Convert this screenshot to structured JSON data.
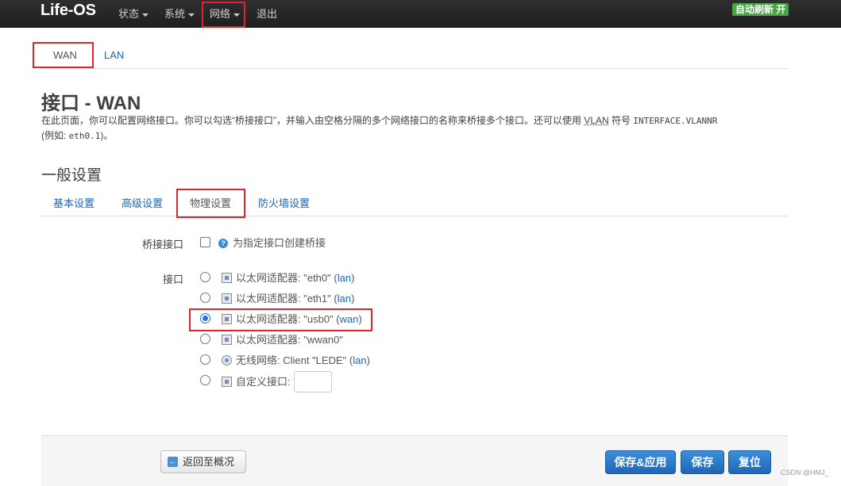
{
  "navbar": {
    "brand": "Life-OS",
    "menu": [
      {
        "label": "状态"
      },
      {
        "label": "系统"
      },
      {
        "label": "网络"
      },
      {
        "label": "退出"
      }
    ],
    "autorefresh": "自动刷新 开"
  },
  "page_tabs": [
    {
      "label": "WAN",
      "active": true
    },
    {
      "label": "LAN",
      "active": false
    }
  ],
  "title": "接口 - WAN",
  "description": {
    "text1": "在此页面，你可以配置网络接口。你可以勾选“桥接接口”，并输入由空格分隔的多个网络接口的名称来桥接多个接口。还可以使用 ",
    "vlan": "VLAN",
    "text2": " 符号 ",
    "mono1": "INTERFACE.VLANNR",
    "text3": "(例如: ",
    "mono2": "eth0.1",
    "text4": ")。"
  },
  "section_title": "一般设置",
  "section_tabs": [
    {
      "label": "基本设置"
    },
    {
      "label": "高级设置"
    },
    {
      "label": "物理设置"
    },
    {
      "label": "防火墙设置"
    }
  ],
  "bridge": {
    "label": "桥接接口",
    "checked": false,
    "help_text": "为指定接口创建桥接"
  },
  "interface": {
    "label": "接口",
    "options": [
      {
        "text": "以太网适配器: \"eth0\"",
        "zone": "lan",
        "icon": "ethernet-icon",
        "checked": false
      },
      {
        "text": "以太网适配器: \"eth1\"",
        "zone": "lan",
        "icon": "ethernet-icon",
        "checked": false
      },
      {
        "text": "以太网适配器: \"usb0\"",
        "zone": "wan",
        "icon": "ethernet-icon",
        "checked": true
      },
      {
        "text": "以太网适配器: \"wwan0\"",
        "zone": "",
        "icon": "ethernet-icon",
        "checked": false
      },
      {
        "text": "无线网络: Client \"LEDE\"",
        "zone": "lan",
        "icon": "wifi-icon",
        "checked": false
      },
      {
        "text": "自定义接口:",
        "zone": "",
        "icon": "ethernet-icon",
        "checked": false
      }
    ],
    "custom_value": ""
  },
  "footer": {
    "back_label": "返回至概况",
    "save_apply_label": "保存&应用",
    "save_label": "保存",
    "reset_label": "复位"
  },
  "watermark": "CSDN @HMJ_",
  "colors": {
    "navbar": "#222222",
    "link": "#1f66b3",
    "primary_button": "#2a7bc9",
    "autorefresh": "#46a546",
    "highlight": "#e0242c"
  }
}
